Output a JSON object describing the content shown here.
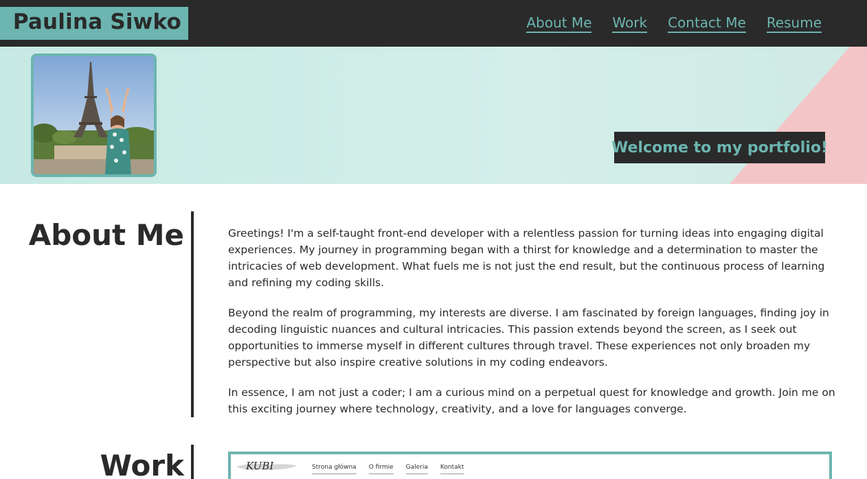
{
  "header": {
    "brand": "Paulina Siwko",
    "nav": [
      {
        "label": "About Me"
      },
      {
        "label": "Work"
      },
      {
        "label": "Contact Me"
      },
      {
        "label": "Resume"
      }
    ]
  },
  "hero": {
    "welcome": "Welcome to my portfolio!"
  },
  "about": {
    "title": "About Me",
    "paragraphs": [
      "Greetings! I'm a self-taught front-end developer with a relentless passion for turning ideas into engaging digital experiences. My journey in programming began with a thirst for knowledge and a determination to master the intricacies of web development. What fuels me is not just the end result, but the continuous process of learning and refining my coding skills.",
      "Beyond the realm of programming, my interests are diverse. I am fascinated by foreign languages, finding joy in decoding linguistic nuances and cultural intricacies. This passion extends beyond the screen, as I seek out opportunities to immerse myself in different cultures through travel. These experiences not only broaden my perspective but also inspire creative solutions in my coding endeavors.",
      "In essence, I am not just a coder; I am a curious mind on a perpetual quest for knowledge and growth. Join me on this exciting journey where technology, creativity, and a love for languages converge."
    ]
  },
  "work": {
    "title": "Work",
    "preview": {
      "logo": "KUBI",
      "nav": [
        "Strona główna",
        "O firmie",
        "Galeria",
        "Kontakt"
      ]
    }
  },
  "colors": {
    "accent": "#6cb5b0",
    "dark": "#2a2a2a",
    "hero_bg": "#d0ece7",
    "hero_pink": "#f4c5c7"
  }
}
